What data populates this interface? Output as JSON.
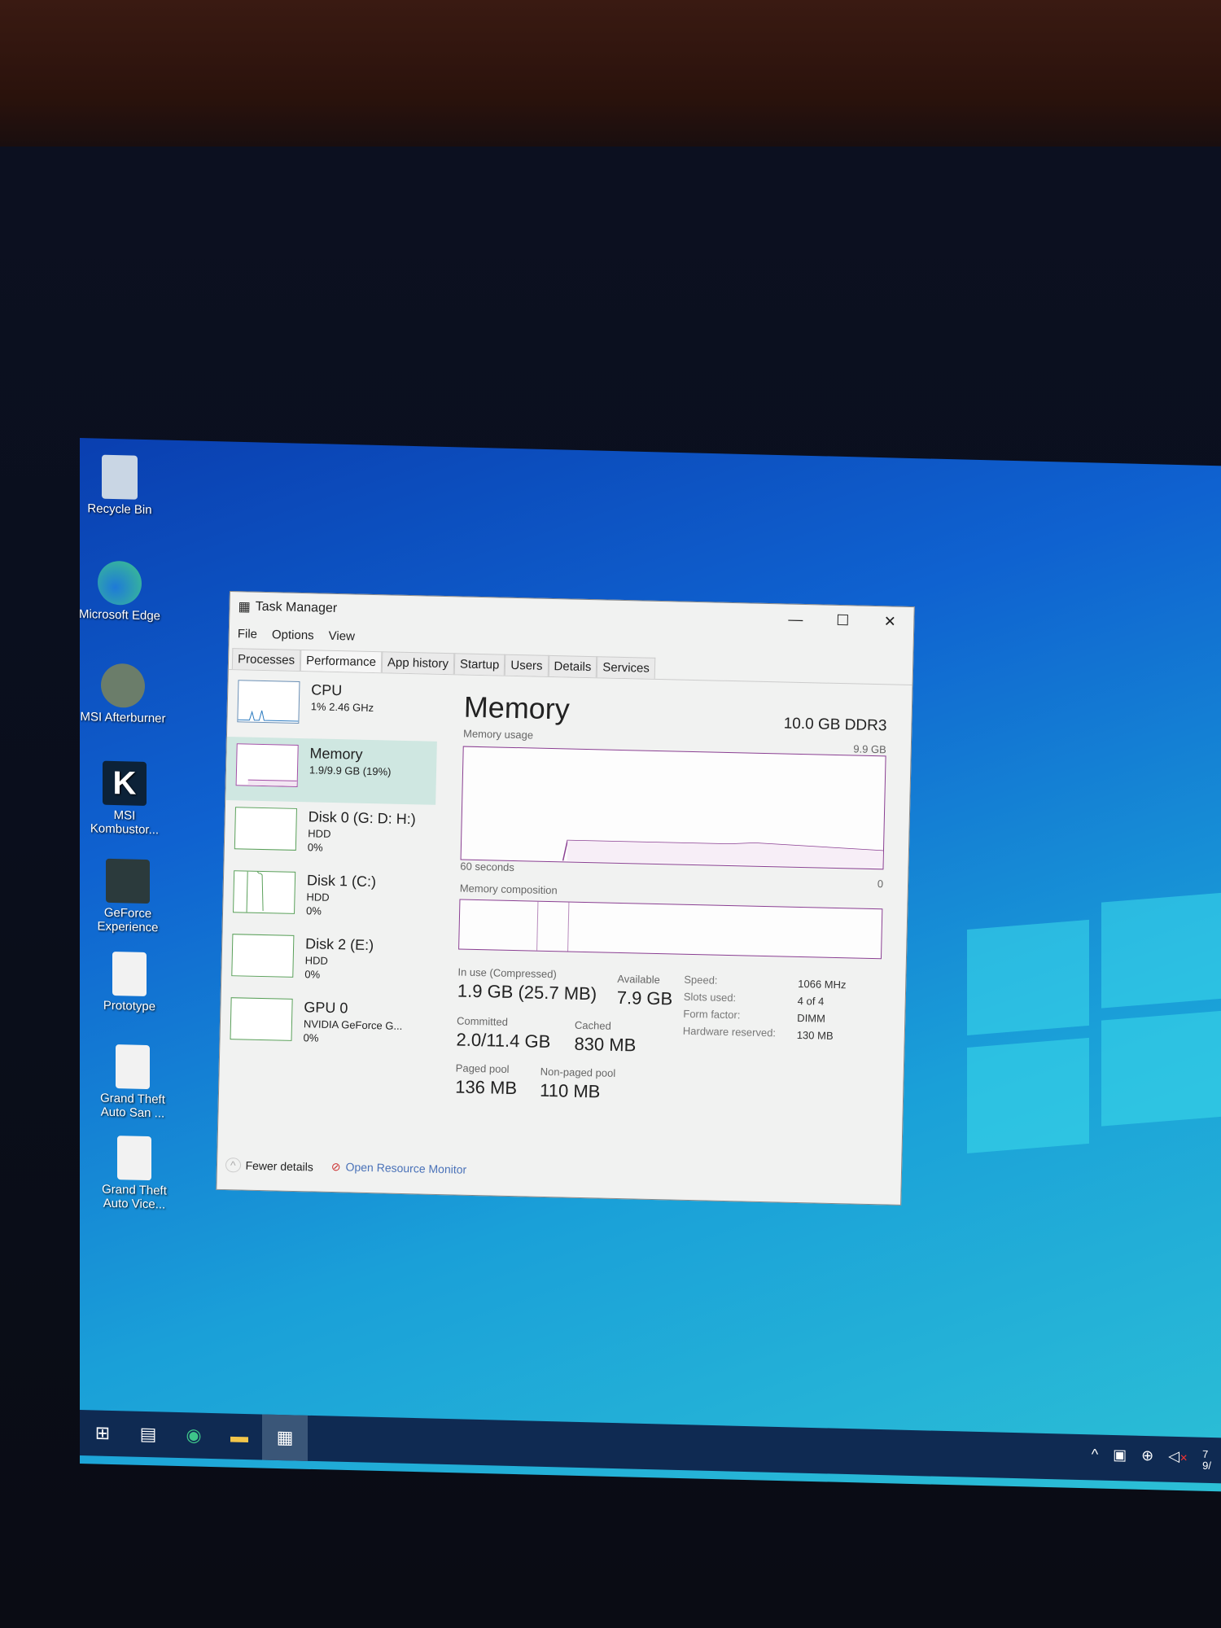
{
  "desktop": {
    "icons": [
      {
        "label": "Recycle Bin",
        "icon": "recycle-bin-icon"
      },
      {
        "label": "Microsoft Edge",
        "icon": "edge-icon"
      },
      {
        "label": "MSI Afterburner",
        "icon": "afterburner-icon"
      },
      {
        "label": "MSI Kombustor...",
        "icon": "kombustor-icon"
      },
      {
        "label": "GeForce Experience",
        "icon": "geforce-icon"
      },
      {
        "label": "Prototype",
        "icon": "file-icon"
      },
      {
        "label": "Grand Theft Auto San ...",
        "icon": "file-icon"
      },
      {
        "label": "Grand Theft Auto Vice...",
        "icon": "file-icon"
      }
    ]
  },
  "window": {
    "title": "Task Manager",
    "menu": [
      "File",
      "Options",
      "View"
    ],
    "tabs": [
      "Processes",
      "Performance",
      "App history",
      "Startup",
      "Users",
      "Details",
      "Services"
    ],
    "active_tab": "Performance"
  },
  "sidebar": [
    {
      "name": "CPU",
      "line2": "1% 2.46 GHz",
      "line3": ""
    },
    {
      "name": "Memory",
      "line2": "1.9/9.9 GB (19%)",
      "line3": ""
    },
    {
      "name": "Disk 0 (G: D: H:)",
      "line2": "HDD",
      "line3": "0%"
    },
    {
      "name": "Disk 1 (C:)",
      "line2": "HDD",
      "line3": "0%"
    },
    {
      "name": "Disk 2 (E:)",
      "line2": "HDD",
      "line3": "0%"
    },
    {
      "name": "GPU 0",
      "line2": "NVIDIA GeForce G...",
      "line3": "0%"
    }
  ],
  "memory": {
    "title": "Memory",
    "spec": "10.0 GB DDR3",
    "usage_label": "Memory usage",
    "usage_max": "9.9 GB",
    "time_label": "60 seconds",
    "zero": "0",
    "composition_label": "Memory composition",
    "in_use_label": "In use (Compressed)",
    "in_use": "1.9 GB (25.7 MB)",
    "available_label": "Available",
    "available": "7.9 GB",
    "committed_label": "Committed",
    "committed": "2.0/11.4 GB",
    "cached_label": "Cached",
    "cached": "830 MB",
    "paged_label": "Paged pool",
    "paged": "136 MB",
    "nonpaged_label": "Non-paged pool",
    "nonpaged": "110 MB",
    "speed_label": "Speed:",
    "speed": "1066 MHz",
    "slots_label": "Slots used:",
    "slots": "4 of 4",
    "form_label": "Form factor:",
    "form": "DIMM",
    "hw_label": "Hardware reserved:",
    "hw": "130 MB"
  },
  "footer": {
    "fewer": "Fewer details",
    "monitor": "Open Resource Monitor"
  },
  "tray": {
    "clock_partial": "7",
    "date_partial": "9/"
  },
  "colors": {
    "memory_accent": "#8a3f92",
    "disk_accent": "#5aa05a",
    "selected": "#cfe7e1"
  }
}
